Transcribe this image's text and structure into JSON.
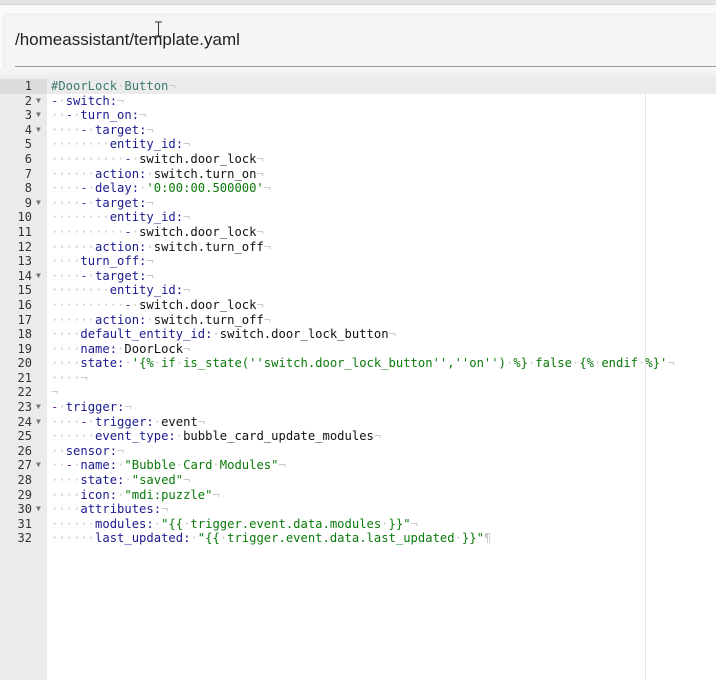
{
  "header": {
    "file_path": "/homeassistant/template.yaml"
  },
  "editor": {
    "active_line": 1,
    "foldable_lines": [
      2,
      3,
      4,
      9,
      14,
      23,
      24,
      27,
      30
    ],
    "lines": [
      "#DoorLock Button",
      "- switch:",
      "  - turn_on:",
      "    - target:",
      "        entity_id:",
      "          - switch.door_lock",
      "      action: switch.turn_on",
      "    - delay: '0:00:00.500000'",
      "    - target:",
      "        entity_id:",
      "          - switch.door_lock",
      "      action: switch.turn_off",
      "    turn_off:",
      "    - target:",
      "        entity_id:",
      "          - switch.door_lock",
      "      action: switch.turn_off",
      "    default_entity_id: switch.door_lock_button",
      "    name: DoorLock",
      "    state: '{% if is_state(''switch.door_lock_button'',''on'') %} false {% endif %}'",
      "    ",
      "",
      "- trigger:",
      "    - trigger: event",
      "      event_type: bubble_card_update_modules",
      "  sensor:",
      "  - name: \"Bubble Card Modules\"",
      "    state: \"saved\"",
      "    icon: \"mdi:puzzle\"",
      "    attributes:",
      "      modules: \"{{ trigger.event.data.modules }}\"",
      "      last_updated: \"{{ trigger.event.data.last_updated }}\""
    ]
  }
}
